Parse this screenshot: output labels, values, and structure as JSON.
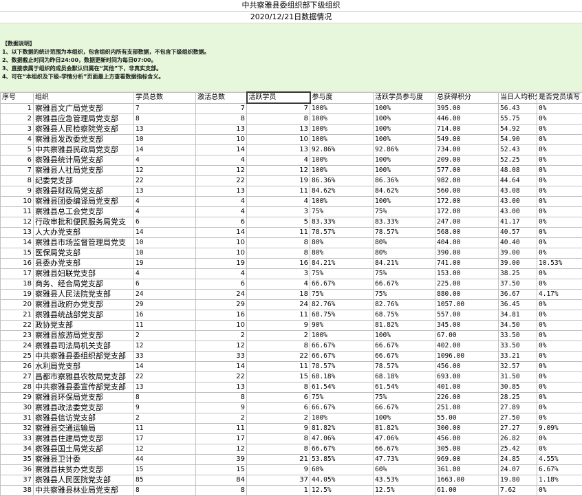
{
  "title": "中共察雅县委组织部下级组织",
  "subtitle": "2020/12/21日数据情况",
  "notes": {
    "heading": "【数据说明】",
    "lines": [
      "1、以下数据的统计范围为本组织，包含组织内所有支部数据，不包含下级组织数据。",
      "2、数据截止时间为昨日24:00，数据更新时间为每日07:00。",
      "3、直接隶属于组织的成员会默认归属在“其他”下，非真实支部。",
      "4、可在“本组织及下级-学情分析”页面最上方查看数据指标含义。"
    ]
  },
  "columns": [
    "序号",
    "组织",
    "学员总数",
    "激活总数",
    "活跃学员",
    "参与度",
    "活跃学员参与度",
    "总获得积分",
    "当日人均积分",
    "是否党员填写"
  ],
  "rows": [
    [
      "1",
      "察雅县文广局党支部",
      "7",
      "7",
      "7",
      "100%",
      "100%",
      "395.00",
      "56.43",
      "0%"
    ],
    [
      "2",
      "察雅县应急管理局党支部",
      "8",
      "8",
      "8",
      "100%",
      "100%",
      "446.00",
      "55.75",
      "0%"
    ],
    [
      "3",
      "察雅县人民检察院党支部",
      "13",
      "13",
      "13",
      "100%",
      "100%",
      "714.00",
      "54.92",
      "0%"
    ],
    [
      "4",
      "察雅县发改委党支部",
      "10",
      "10",
      "10",
      "100%",
      "100%",
      "549.00",
      "54.90",
      "0%"
    ],
    [
      "5",
      "中共察雅县民政局党支部",
      "14",
      "14",
      "13",
      "92.86%",
      "92.86%",
      "734.00",
      "52.43",
      "0%"
    ],
    [
      "6",
      "察雅县统计局党支部",
      "4",
      "4",
      "4",
      "100%",
      "100%",
      "209.00",
      "52.25",
      "0%"
    ],
    [
      "7",
      "察雅县人社局党支部",
      "12",
      "12",
      "12",
      "100%",
      "100%",
      "577.00",
      "48.08",
      "0%"
    ],
    [
      "8",
      "纪委党支部",
      "22",
      "22",
      "19",
      "86.36%",
      "86.36%",
      "982.00",
      "44.64",
      "0%"
    ],
    [
      "9",
      "察雅县财政局党支部",
      "13",
      "13",
      "11",
      "84.62%",
      "84.62%",
      "560.00",
      "43.08",
      "0%"
    ],
    [
      "10",
      "察雅县团委编译局党支部",
      "4",
      "4",
      "4",
      "100%",
      "100%",
      "172.00",
      "43.00",
      "0%"
    ],
    [
      "11",
      "察雅县总工会党支部",
      "4",
      "4",
      "3",
      "75%",
      "75%",
      "172.00",
      "43.00",
      "0%"
    ],
    [
      "12",
      "行政审批和便民服务局党支",
      "6",
      "6",
      "5",
      "83.33%",
      "83.33%",
      "247.00",
      "41.17",
      "0%"
    ],
    [
      "13",
      "人大办党支部",
      "14",
      "14",
      "11",
      "78.57%",
      "78.57%",
      "568.00",
      "40.57",
      "0%"
    ],
    [
      "14",
      "察雅县市场监督管理局党支",
      "10",
      "10",
      "8",
      "80%",
      "80%",
      "404.00",
      "40.40",
      "0%"
    ],
    [
      "15",
      "医保局党支部",
      "10",
      "10",
      "8",
      "80%",
      "80%",
      "390.00",
      "39.00",
      "0%"
    ],
    [
      "16",
      "县委办党支部",
      "19",
      "19",
      "16",
      "84.21%",
      "84.21%",
      "741.00",
      "39.00",
      "10.53%"
    ],
    [
      "17",
      "察雅县妇联党支部",
      "4",
      "4",
      "3",
      "75%",
      "75%",
      "153.00",
      "38.25",
      "0%"
    ],
    [
      "18",
      "商务、经合局党支部",
      "6",
      "6",
      "4",
      "66.67%",
      "66.67%",
      "225.00",
      "37.50",
      "0%"
    ],
    [
      "19",
      "察雅县人民法院党支部",
      "24",
      "24",
      "18",
      "75%",
      "75%",
      "880.00",
      "36.67",
      "4.17%"
    ],
    [
      "20",
      "察雅县政府办党支部",
      "29",
      "29",
      "24",
      "82.76%",
      "82.76%",
      "1057.00",
      "36.45",
      "0%"
    ],
    [
      "21",
      "察雅县统战部党支部",
      "16",
      "16",
      "11",
      "68.75%",
      "68.75%",
      "557.00",
      "34.81",
      "0%"
    ],
    [
      "22",
      "政协党支部",
      "11",
      "10",
      "9",
      "90%",
      "81.82%",
      "345.00",
      "34.50",
      "0%"
    ],
    [
      "23",
      "察雅县旅游局党支部",
      "2",
      "2",
      "2",
      "100%",
      "100%",
      "67.00",
      "33.50",
      "0%"
    ],
    [
      "24",
      "察雅县司法局机关支部",
      "12",
      "12",
      "8",
      "66.67%",
      "66.67%",
      "402.00",
      "33.50",
      "0%"
    ],
    [
      "25",
      "中共察雅县委组织部党支部",
      "33",
      "33",
      "22",
      "66.67%",
      "66.67%",
      "1096.00",
      "33.21",
      "0%"
    ],
    [
      "26",
      "水利局党支部",
      "14",
      "14",
      "11",
      "78.57%",
      "78.57%",
      "456.00",
      "32.57",
      "0%"
    ],
    [
      "27",
      "昌都市察雅县农牧局党支部",
      "22",
      "22",
      "15",
      "68.18%",
      "68.18%",
      "693.00",
      "31.50",
      "0%"
    ],
    [
      "28",
      "中共察雅县委宣传部党支部",
      "13",
      "13",
      "8",
      "61.54%",
      "61.54%",
      "401.00",
      "30.85",
      "0%"
    ],
    [
      "29",
      "察雅县环保局党支部",
      "8",
      "8",
      "6",
      "75%",
      "75%",
      "226.00",
      "28.25",
      "0%"
    ],
    [
      "30",
      "察雅县政法委党支部",
      "9",
      "9",
      "6",
      "66.67%",
      "66.67%",
      "251.00",
      "27.89",
      "0%"
    ],
    [
      "31",
      "察雅县信访党支部",
      "2",
      "2",
      "2",
      "100%",
      "100%",
      "55.00",
      "27.50",
      "0%"
    ],
    [
      "32",
      "察雅县交通运输局",
      "11",
      "11",
      "9",
      "81.82%",
      "81.82%",
      "300.00",
      "27.27",
      "9.09%"
    ],
    [
      "33",
      "察雅县住建局党支部",
      "17",
      "17",
      "8",
      "47.06%",
      "47.06%",
      "456.00",
      "26.82",
      "0%"
    ],
    [
      "34",
      "察雅县国土局党支部",
      "12",
      "12",
      "8",
      "66.67%",
      "66.67%",
      "305.00",
      "25.42",
      "0%"
    ],
    [
      "35",
      "察雅县卫计委",
      "44",
      "39",
      "21",
      "53.85%",
      "47.73%",
      "969.00",
      "24.85",
      "4.55%"
    ],
    [
      "36",
      "察雅县扶贫办党支部",
      "15",
      "15",
      "9",
      "60%",
      "60%",
      "361.00",
      "24.07",
      "6.67%"
    ],
    [
      "37",
      "察雅县人民医院党支部",
      "85",
      "84",
      "37",
      "44.05%",
      "43.53%",
      "1663.00",
      "19.80",
      "1.18%"
    ],
    [
      "38",
      "中共察雅县林业局党支部",
      "8",
      "8",
      "1",
      "12.5%",
      "12.5%",
      "61.00",
      "7.62",
      "0%"
    ]
  ]
}
